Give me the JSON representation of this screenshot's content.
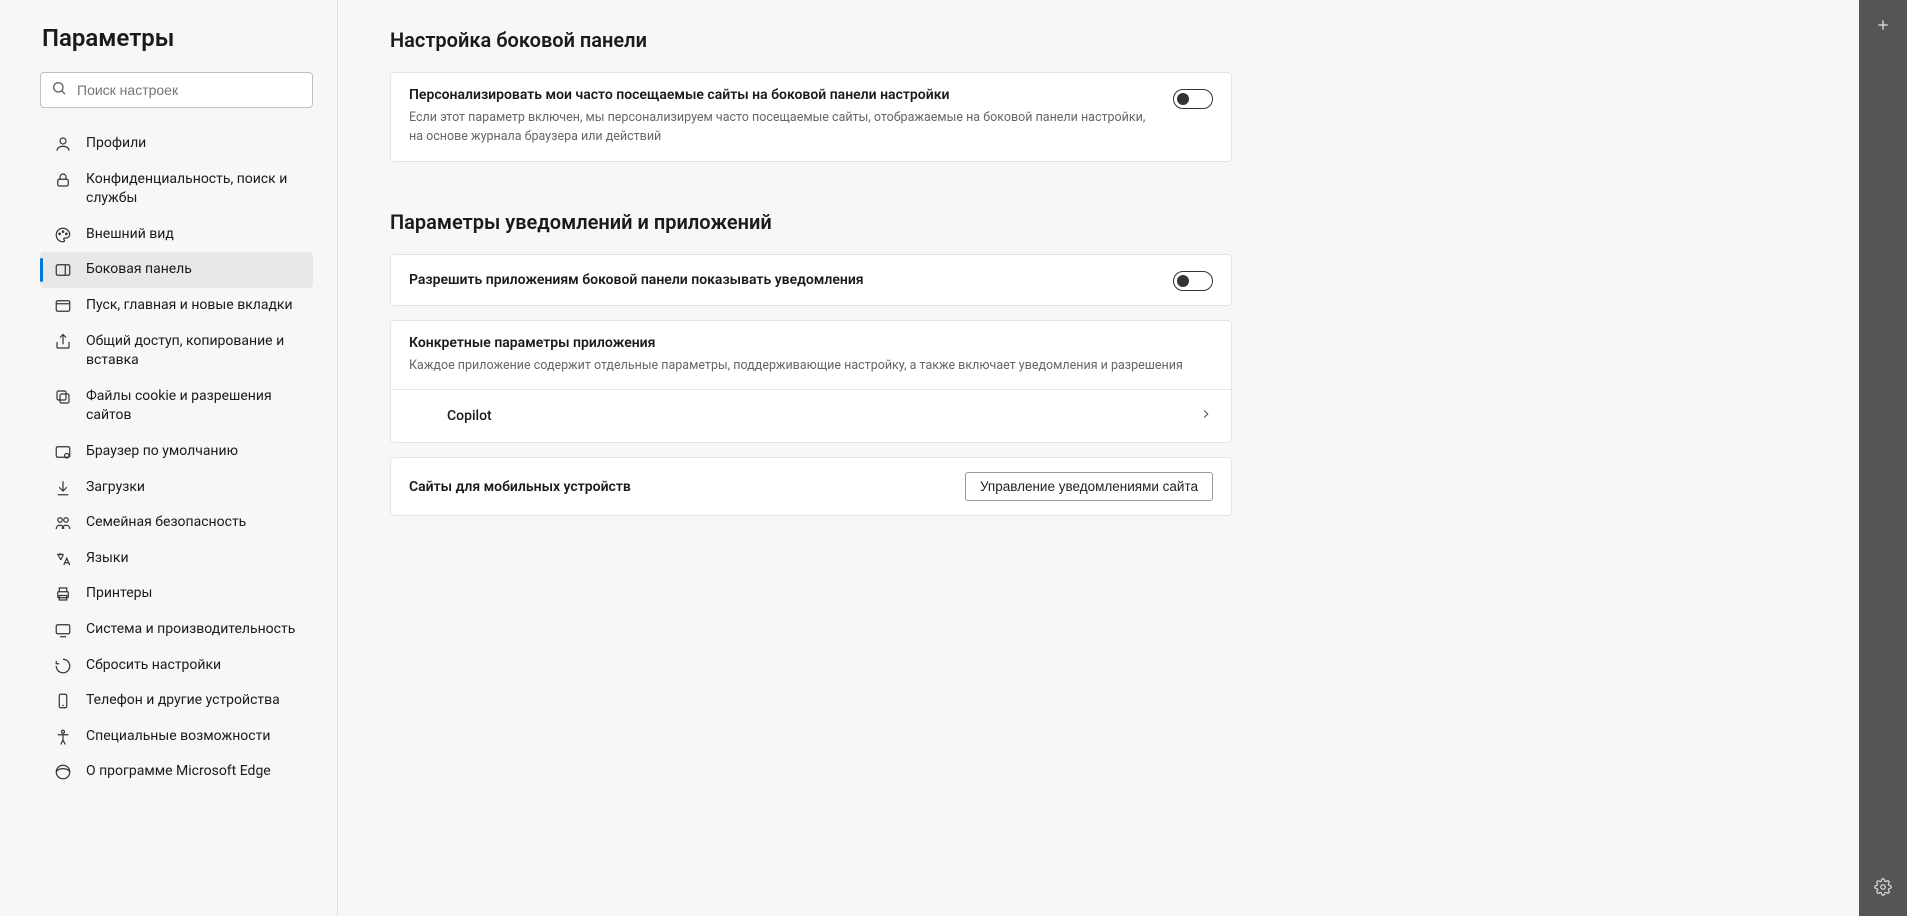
{
  "sidebar": {
    "title": "Параметры",
    "search_placeholder": "Поиск настроек",
    "items": [
      {
        "label": "Профили"
      },
      {
        "label": "Конфиденциальность, поиск и службы"
      },
      {
        "label": "Внешний вид"
      },
      {
        "label": "Боковая панель"
      },
      {
        "label": "Пуск, главная и новые вкладки"
      },
      {
        "label": "Общий доступ, копирование и вставка"
      },
      {
        "label": "Файлы cookie и разрешения сайтов"
      },
      {
        "label": "Браузер по умолчанию"
      },
      {
        "label": "Загрузки"
      },
      {
        "label": "Семейная безопасность"
      },
      {
        "label": "Языки"
      },
      {
        "label": "Принтеры"
      },
      {
        "label": "Система и производительность"
      },
      {
        "label": "Сбросить настройки"
      },
      {
        "label": "Телефон и другие устройства"
      },
      {
        "label": "Специальные возможности"
      },
      {
        "label": "О программе Microsoft Edge"
      }
    ]
  },
  "main": {
    "section1_title": "Настройка боковой панели",
    "personalize": {
      "title": "Персонализировать мои часто посещаемые сайты на боковой панели настройки",
      "desc": "Если этот параметр включен, мы персонализируем часто посещаемые сайты, отображаемые на боковой панели настройки, на основе журнала браузера или действий",
      "value": false
    },
    "section2_title": "Параметры уведомлений и приложений",
    "allow_notifications": {
      "title": "Разрешить приложениям боковой панели показывать уведомления",
      "value": false
    },
    "app_specific": {
      "title": "Конкретные параметры приложения",
      "desc": "Каждое приложение содержит отдельные параметры, поддерживающие настройку, а также включает уведомления и разрешения",
      "apps": [
        {
          "name": "Copilot"
        }
      ]
    },
    "mobile_sites": {
      "title": "Сайты для мобильных устройств",
      "button": "Управление уведомлениями сайта"
    }
  }
}
